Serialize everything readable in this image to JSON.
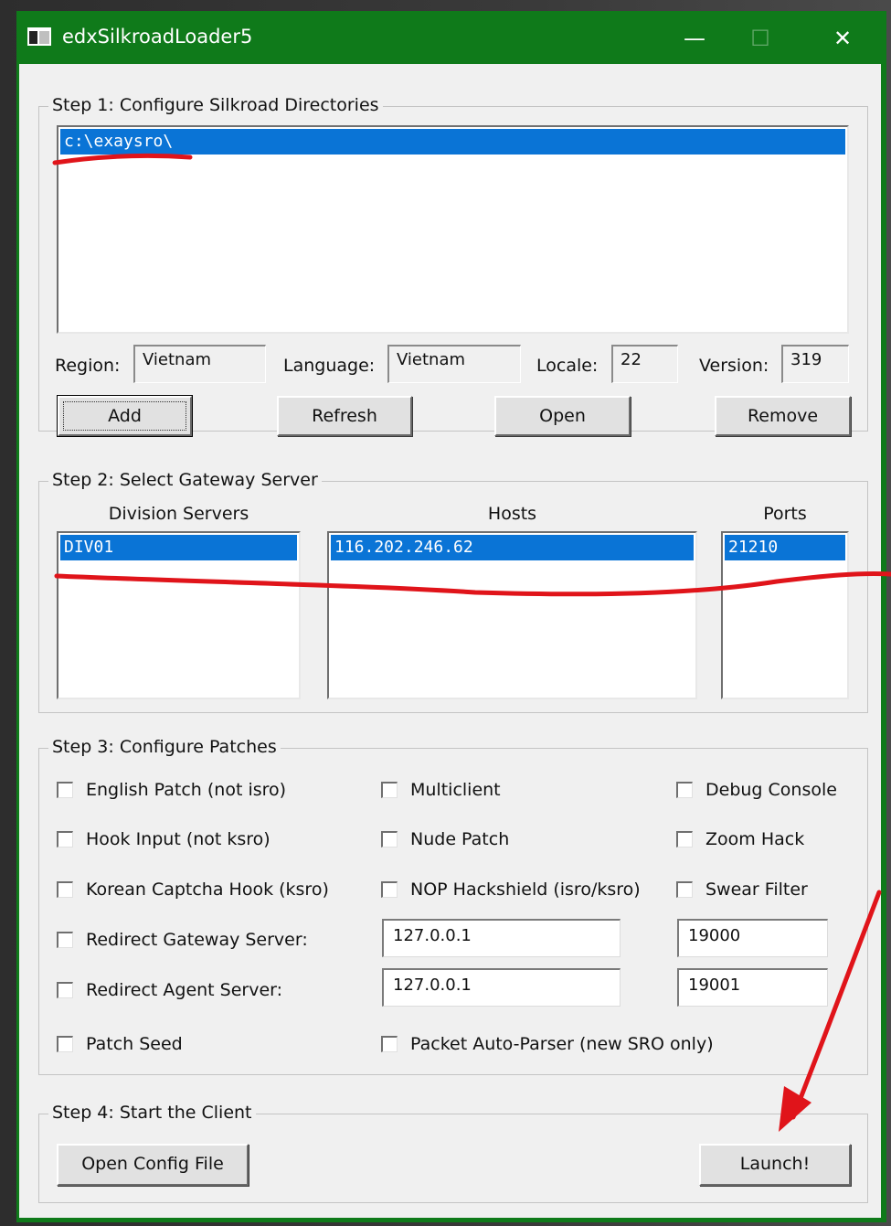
{
  "window": {
    "title": "edxSilkroadLoader5",
    "minimize_glyph": "—",
    "maximize_glyph": "☐",
    "close_glyph": "✕"
  },
  "step1": {
    "title": "Step 1: Configure Silkroad Directories",
    "directories": [
      "c:\\exaysro\\"
    ],
    "region_label": "Region:",
    "region_value": "Vietnam",
    "language_label": "Language:",
    "language_value": "Vietnam",
    "locale_label": "Locale:",
    "locale_value": "22",
    "version_label": "Version:",
    "version_value": "319",
    "add_label": "Add",
    "refresh_label": "Refresh",
    "open_label": "Open",
    "remove_label": "Remove"
  },
  "step2": {
    "title": "Step 2: Select Gateway Server",
    "division_header": "Division Servers",
    "hosts_header": "Hosts",
    "ports_header": "Ports",
    "divisions": [
      "DIV01"
    ],
    "hosts": [
      "116.202.246.62"
    ],
    "ports": [
      "21210"
    ]
  },
  "step3": {
    "title": "Step 3: Configure Patches",
    "english_patch": "English Patch (not isro)",
    "multiclient": "Multiclient",
    "debug_console": "Debug Console",
    "hook_input": "Hook Input (not ksro)",
    "nude_patch": "Nude Patch",
    "zoom_hack": "Zoom Hack",
    "korean_captcha": "Korean Captcha Hook (ksro)",
    "nop_hackshield": "NOP Hackshield (isro/ksro)",
    "swear_filter": "Swear Filter",
    "redirect_gateway": "Redirect Gateway Server:",
    "gateway_ip": "127.0.0.1",
    "gateway_port": "19000",
    "redirect_agent": "Redirect Agent Server:",
    "agent_ip": "127.0.0.1",
    "agent_port": "19001",
    "patch_seed": "Patch Seed",
    "packet_parser": "Packet Auto-Parser (new SRO only)"
  },
  "step4": {
    "title": "Step 4: Start the Client",
    "open_config_label": "Open Config File",
    "launch_label": "Launch!"
  },
  "colors": {
    "titlebar": "#0f7a1a",
    "selection": "#0a74d6",
    "annotation": "#e0141a"
  }
}
